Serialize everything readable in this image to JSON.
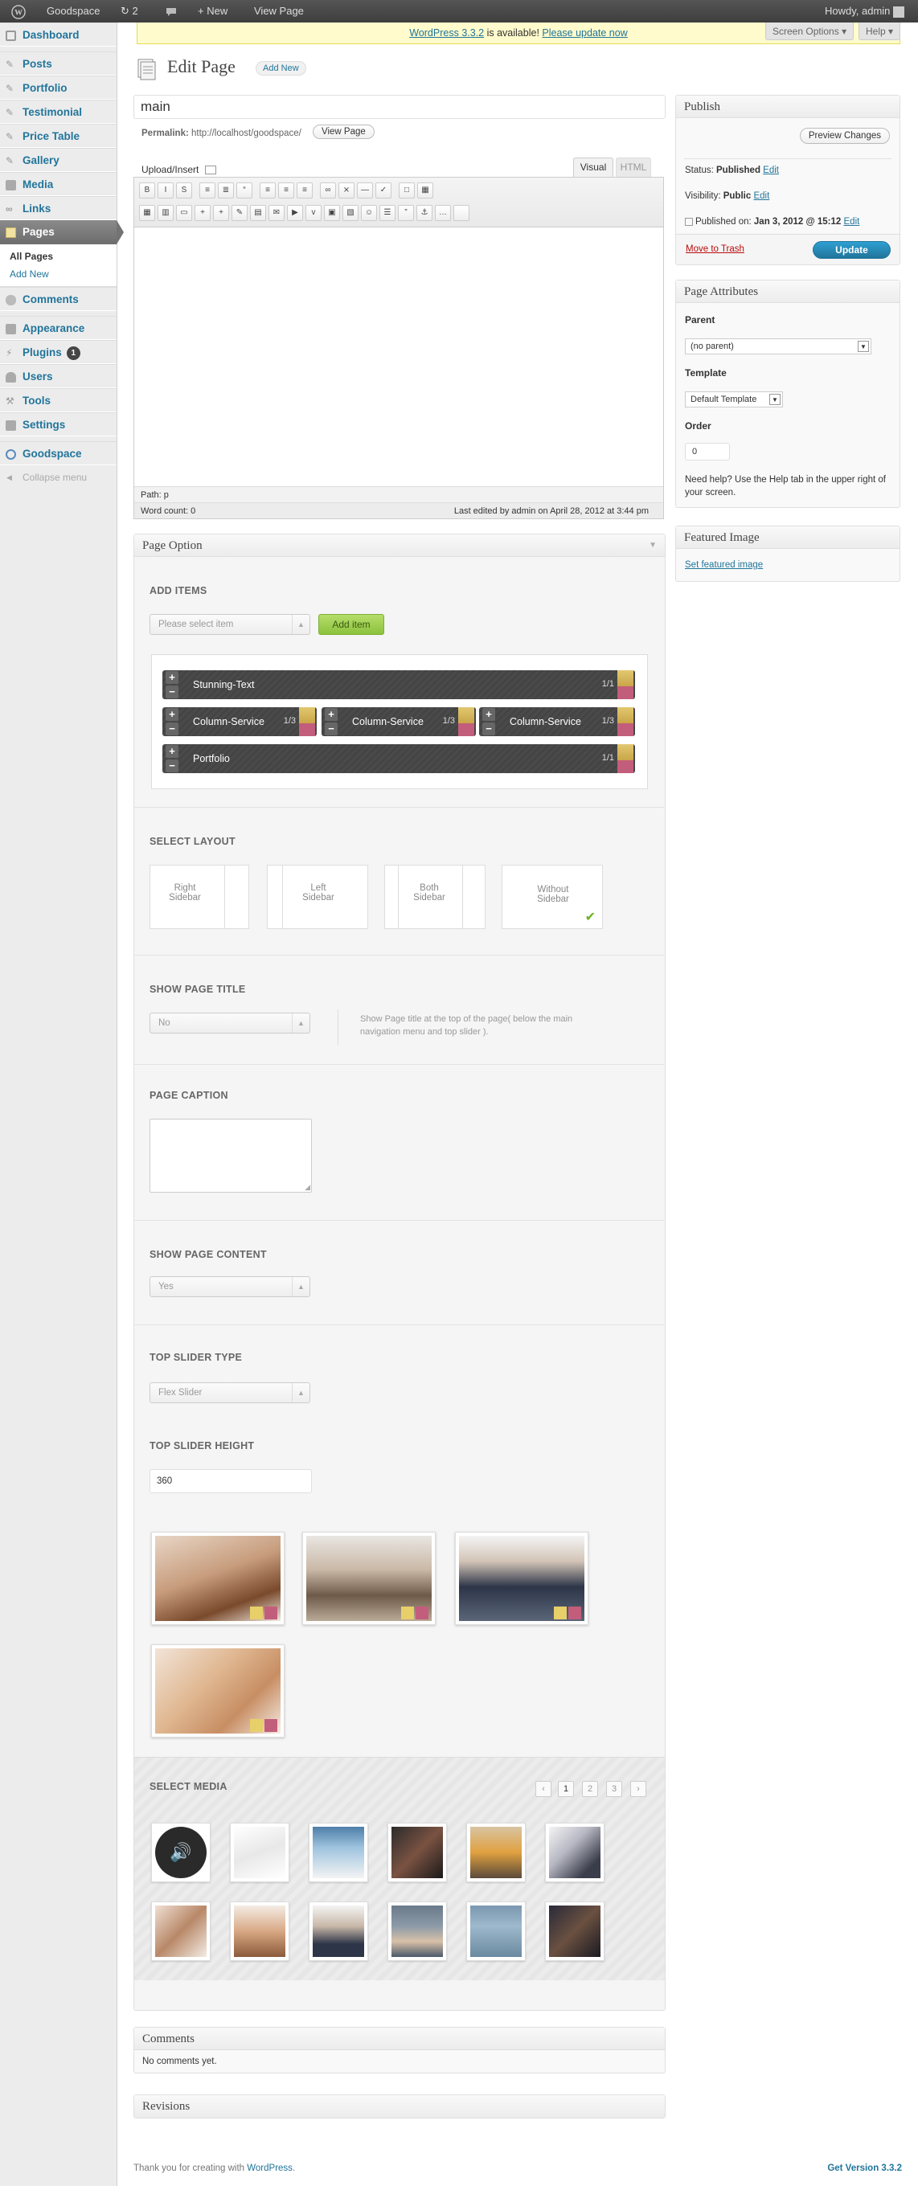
{
  "adminbar": {
    "site": "Goodspace",
    "updates": "2",
    "new": "New",
    "view_page": "View Page",
    "howdy": "Howdy, admin"
  },
  "menu": {
    "dashboard": "Dashboard",
    "posts": "Posts",
    "portfolio": "Portfolio",
    "testimonial": "Testimonial",
    "price_table": "Price Table",
    "gallery": "Gallery",
    "media": "Media",
    "links": "Links",
    "pages": "Pages",
    "all_pages": "All Pages",
    "add_new": "Add New",
    "comments": "Comments",
    "appearance": "Appearance",
    "plugins": "Plugins",
    "plugins_badge": "1",
    "users": "Users",
    "tools": "Tools",
    "settings": "Settings",
    "goodspace": "Goodspace",
    "collapse": "Collapse menu"
  },
  "notice": {
    "link1": "WordPress 3.3.2",
    "text": " is available! ",
    "link2": "Please update now"
  },
  "screen_options": "Screen Options",
  "help": "Help",
  "header": {
    "title": "Edit Page",
    "add_new": "Add New"
  },
  "editor": {
    "title_value": "main",
    "permalink_label": "Permalink:",
    "permalink_url": "http://localhost/goodspace/",
    "view_page": "View Page",
    "upload_insert": "Upload/Insert",
    "tab_visual": "Visual",
    "tab_html": "HTML",
    "path_label": "Path:",
    "path_value": "p",
    "word_count": "Word count: 0",
    "last_edited": "Last edited by admin on April 28, 2012 at 3:44 pm"
  },
  "publish": {
    "title": "Publish",
    "preview": "Preview Changes",
    "status_label": "Status:",
    "status_value": "Published",
    "edit": "Edit",
    "visibility_label": "Visibility:",
    "visibility_value": "Public",
    "published_label": "Published on:",
    "published_value": "Jan 3, 2012 @ 15:12",
    "trash": "Move to Trash",
    "update": "Update"
  },
  "attributes": {
    "title": "Page Attributes",
    "parent_label": "Parent",
    "parent_value": "(no parent)",
    "template_label": "Template",
    "template_value": "Default Template",
    "order_label": "Order",
    "order_value": "0",
    "help": "Need help? Use the Help tab in the upper right of your screen."
  },
  "featured": {
    "title": "Featured Image",
    "link": "Set featured image"
  },
  "page_option": {
    "title": "Page Option",
    "add_items": "ADD ITEMS",
    "select_placeholder": "Please select item",
    "add_item_btn": "Add item",
    "items": [
      {
        "row": [
          {
            "label": "Stunning-Text",
            "ratio": "1/1"
          }
        ]
      },
      {
        "row": [
          {
            "label": "Column-Service",
            "ratio": "1/3"
          },
          {
            "label": "Column-Service",
            "ratio": "1/3"
          },
          {
            "label": "Column-Service",
            "ratio": "1/3"
          }
        ]
      },
      {
        "row": [
          {
            "label": "Portfolio",
            "ratio": "1/1"
          }
        ]
      }
    ],
    "select_layout": "SELECT LAYOUT",
    "layouts": [
      "Right\nSidebar",
      "Left\nSidebar",
      "Both\nSidebar",
      "Without\nSidebar"
    ],
    "show_title": "SHOW PAGE TITLE",
    "show_title_value": "No",
    "show_title_desc": "Show Page title at the top of the page( below the main navigation menu and top slider ).",
    "caption": "PAGE CAPTION",
    "show_content": "SHOW PAGE CONTENT",
    "show_content_value": "Yes",
    "slider_type": "TOP SLIDER TYPE",
    "slider_type_value": "Flex Slider",
    "slider_height": "TOP SLIDER HEIGHT",
    "slider_height_value": "360",
    "select_media": "SELECT MEDIA",
    "pages": [
      "1",
      "2",
      "3"
    ]
  },
  "comments": {
    "title": "Comments",
    "empty": "No comments yet."
  },
  "revisions": {
    "title": "Revisions"
  },
  "footer": {
    "thanks": "Thank you for creating with ",
    "wp": "WordPress",
    "dot": ".",
    "version": "Get Version 3.3.2"
  }
}
